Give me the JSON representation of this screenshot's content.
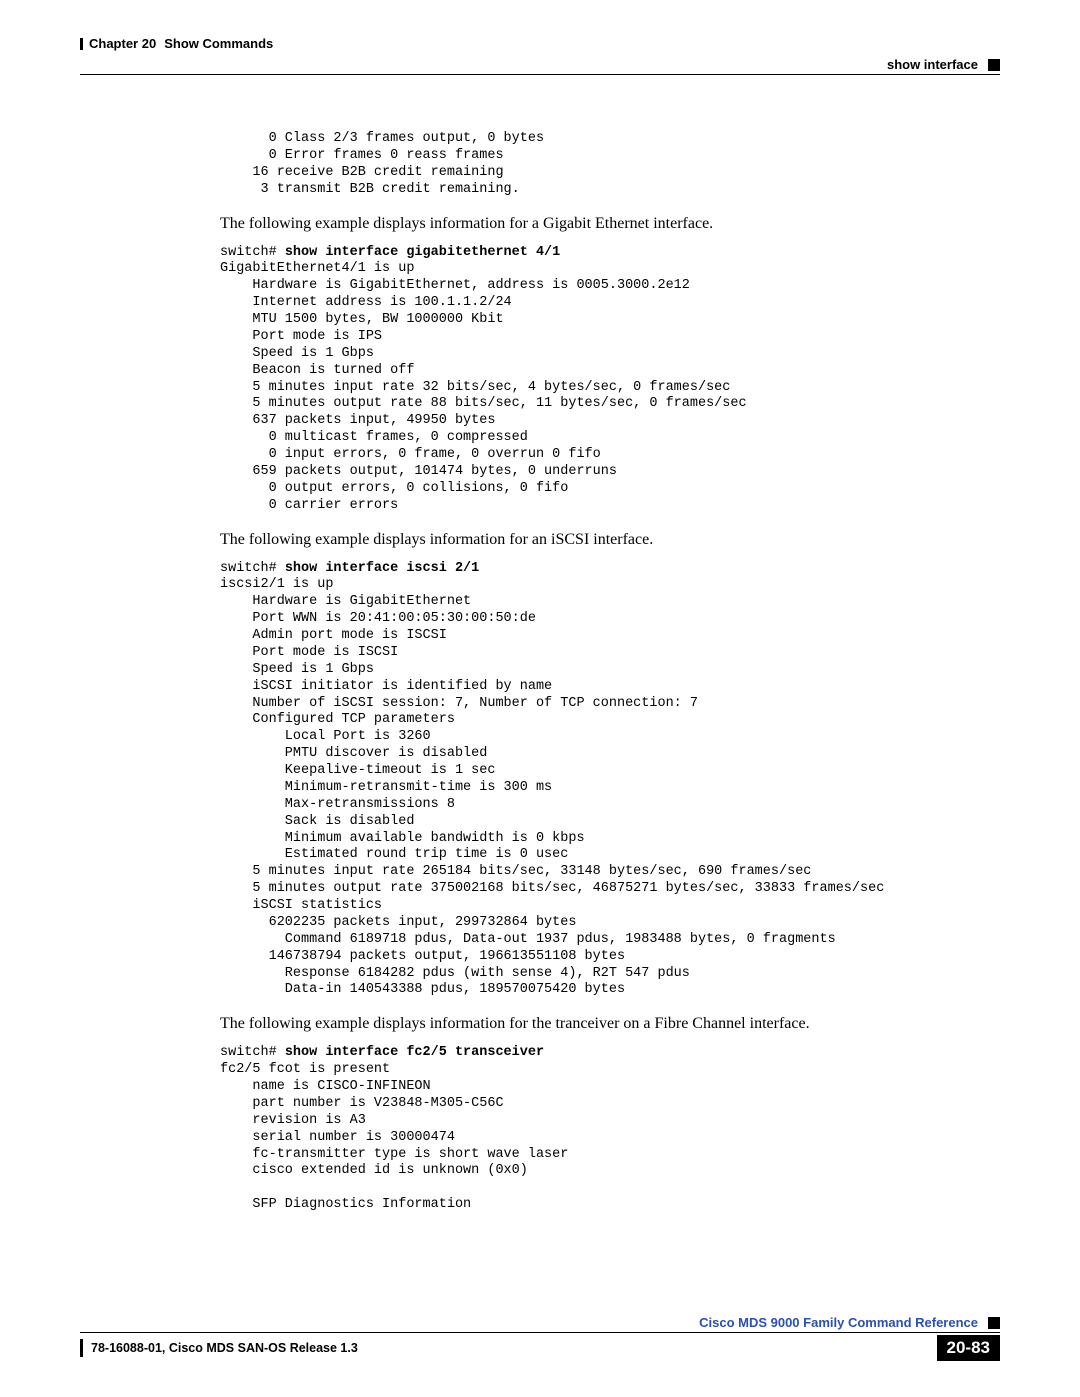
{
  "header": {
    "chapter": "Chapter 20",
    "chapter_title": "Show Commands",
    "section": "show interface"
  },
  "code1_lines": [
    "      0 Class 2/3 frames output, 0 bytes",
    "      0 Error frames 0 reass frames",
    "    16 receive B2B credit remaining",
    "     3 transmit B2B credit remaining."
  ],
  "body1": "The following example displays information for a Gigabit Ethernet interface.",
  "code2_prefix": "switch# ",
  "code2_cmd": "show interface gigabitethernet 4/1",
  "code2_lines": [
    "GigabitEthernet4/1 is up",
    "    Hardware is GigabitEthernet, address is 0005.3000.2e12",
    "    Internet address is 100.1.1.2/24",
    "    MTU 1500 bytes, BW 1000000 Kbit",
    "    Port mode is IPS",
    "    Speed is 1 Gbps",
    "    Beacon is turned off",
    "    5 minutes input rate 32 bits/sec, 4 bytes/sec, 0 frames/sec",
    "    5 minutes output rate 88 bits/sec, 11 bytes/sec, 0 frames/sec",
    "    637 packets input, 49950 bytes",
    "      0 multicast frames, 0 compressed",
    "      0 input errors, 0 frame, 0 overrun 0 fifo",
    "    659 packets output, 101474 bytes, 0 underruns",
    "      0 output errors, 0 collisions, 0 fifo",
    "      0 carrier errors"
  ],
  "body2": "The following example displays information for an iSCSI interface.",
  "code3_prefix": "switch# ",
  "code3_cmd": "show interface iscsi 2/1",
  "code3_lines": [
    "iscsi2/1 is up",
    "    Hardware is GigabitEthernet",
    "    Port WWN is 20:41:00:05:30:00:50:de",
    "    Admin port mode is ISCSI",
    "    Port mode is ISCSI",
    "    Speed is 1 Gbps",
    "    iSCSI initiator is identified by name",
    "    Number of iSCSI session: 7, Number of TCP connection: 7",
    "    Configured TCP parameters",
    "        Local Port is 3260",
    "        PMTU discover is disabled",
    "        Keepalive-timeout is 1 sec",
    "        Minimum-retransmit-time is 300 ms",
    "        Max-retransmissions 8",
    "        Sack is disabled",
    "        Minimum available bandwidth is 0 kbps",
    "        Estimated round trip time is 0 usec",
    "    5 minutes input rate 265184 bits/sec, 33148 bytes/sec, 690 frames/sec",
    "    5 minutes output rate 375002168 bits/sec, 46875271 bytes/sec, 33833 frames/sec",
    "    iSCSI statistics",
    "      6202235 packets input, 299732864 bytes",
    "        Command 6189718 pdus, Data-out 1937 pdus, 1983488 bytes, 0 fragments",
    "      146738794 packets output, 196613551108 bytes",
    "        Response 6184282 pdus (with sense 4), R2T 547 pdus",
    "        Data-in 140543388 pdus, 189570075420 bytes"
  ],
  "body3": "The following example displays information for the tranceiver on a Fibre Channel interface.",
  "code4_prefix": "switch# ",
  "code4_cmd": "show interface fc2/5 transceiver",
  "code4_lines": [
    "fc2/5 fcot is present",
    "    name is CISCO-INFINEON",
    "    part number is V23848-M305-C56C",
    "    revision is A3",
    "    serial number is 30000474",
    "    fc-transmitter type is short wave laser",
    "    cisco extended id is unknown (0x0)",
    "",
    "    SFP Diagnostics Information"
  ],
  "footer": {
    "book_title": "Cisco MDS 9000 Family Command Reference",
    "doc_id": "78-16088-01, Cisco MDS SAN-OS Release 1.3",
    "page_number": "20-83"
  }
}
